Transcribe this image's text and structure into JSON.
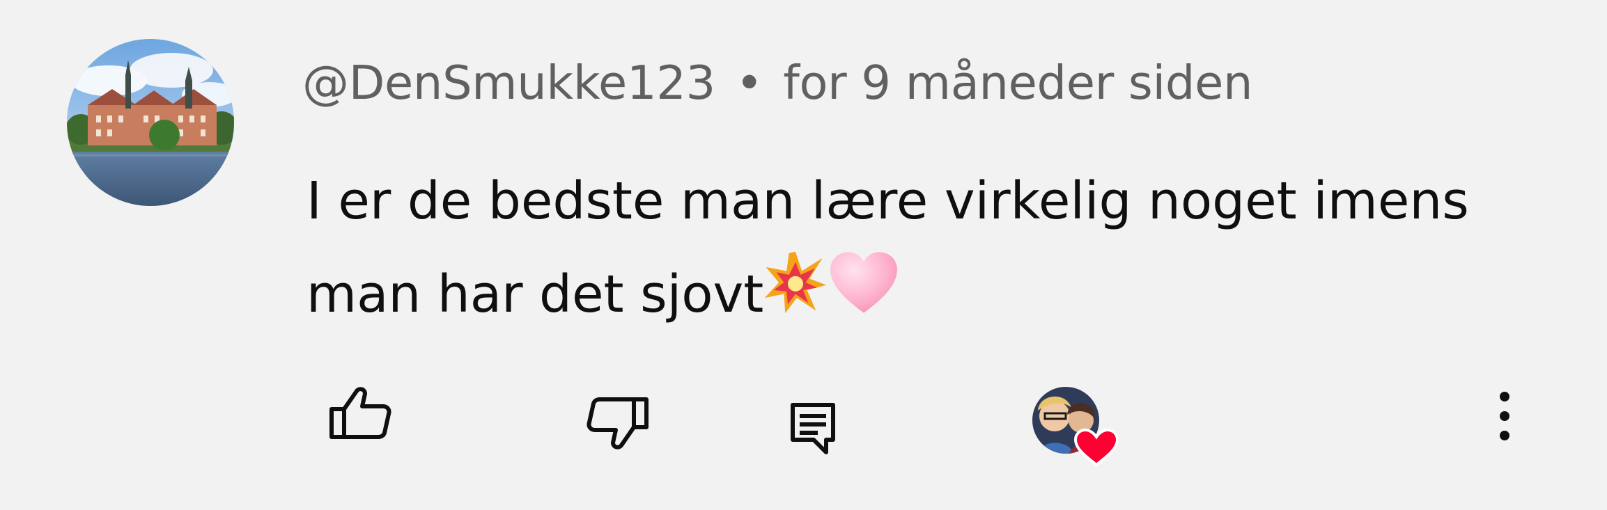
{
  "comment": {
    "username": "@DenSmukke123",
    "separator": "•",
    "time_ago": "for 9 måneder siden",
    "text": "I er de bedste man lære virkelig noget imens man har det sjovt",
    "emojis": [
      "collision-emoji",
      "pink-heart-emoji"
    ]
  },
  "actions": {
    "like_icon": "thumbs-up-icon",
    "dislike_icon": "thumbs-down-icon",
    "reply_icon": "reply-icon",
    "creator_heart": "creator-heart-avatar",
    "more_icon": "more-vertical-icon"
  },
  "colors": {
    "background": "#f2f2f2",
    "username": "#606060",
    "text": "#0f0f0f",
    "heart": "#ff0033",
    "pink_heart": "#ffb3cf"
  }
}
